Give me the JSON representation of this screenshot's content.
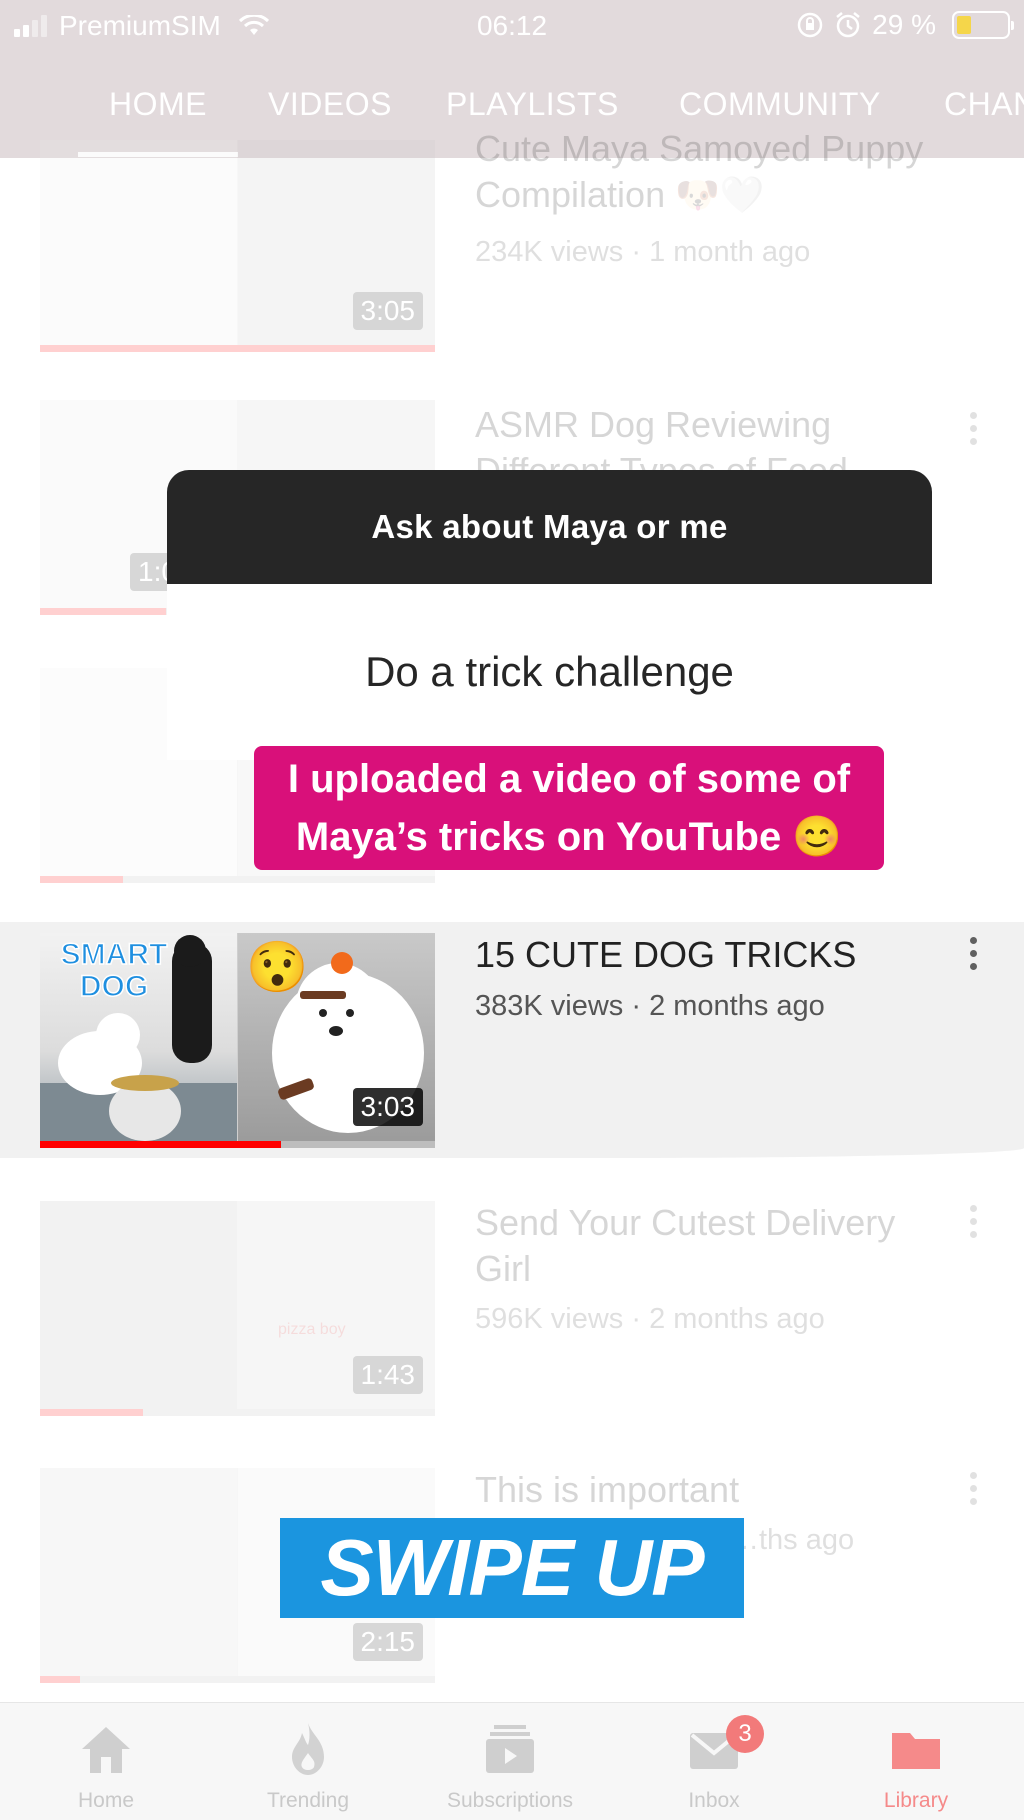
{
  "status_bar": {
    "carrier": "PremiumSIM",
    "time": "06:12",
    "battery": "29 %",
    "battery_level": 0.29
  },
  "channel_tabs": [
    {
      "label": "HOME",
      "active": true
    },
    {
      "label": "VIDEOS",
      "active": false
    },
    {
      "label": "PLAYLISTS",
      "active": false
    },
    {
      "label": "COMMUNITY",
      "active": false
    },
    {
      "label": "CHAN",
      "active": false
    }
  ],
  "videos": [
    {
      "title": "Cute Maya Samoyed Puppy Compilation 🐶🤍",
      "meta": "234K views · 1 month ago",
      "duration": "3:05",
      "watched": 1.0
    },
    {
      "title": "ASMR Dog Reviewing Different Types of Food",
      "meta": "",
      "duration": "1:00",
      "watched": 0.32
    },
    {
      "title": "",
      "meta": "",
      "duration": "",
      "watched": 0.21
    },
    {
      "title": "15 CUTE DOG TRICKS",
      "meta": "383K views · 2 months ago",
      "duration": "3:03",
      "watched": 0.61,
      "thumb_text": "SMART DOG",
      "thumb_emoji": "😯"
    },
    {
      "title": "Send Your Cutest Delivery Girl",
      "meta": "596K views · 2 months ago",
      "duration": "1:43",
      "watched": 0.26,
      "thumb_text": "pizza boy"
    },
    {
      "title": "This is important",
      "meta": "…ths ago",
      "duration": "2:15",
      "watched": 0.1
    }
  ],
  "story": {
    "question": "Ask about Maya or me",
    "answer": "Do a trick challenge",
    "caption": "I uploaded a video of some of Maya’s tricks on YouTube 😊",
    "swipe": "SWIPE UP"
  },
  "bottom_nav": [
    {
      "label": "Home",
      "icon": "home-icon"
    },
    {
      "label": "Trending",
      "icon": "flame-icon"
    },
    {
      "label": "Subscriptions",
      "icon": "subscriptions-icon"
    },
    {
      "label": "Inbox",
      "icon": "inbox-icon",
      "badge": "3"
    },
    {
      "label": "Library",
      "icon": "library-folder-icon",
      "active": true
    }
  ],
  "colors": {
    "youtube_red": "#ff0000",
    "caption_magenta": "#d9107a",
    "swipe_blue": "#1b95df",
    "sticker_dark": "#262626",
    "library_active": "#f26b6b"
  }
}
